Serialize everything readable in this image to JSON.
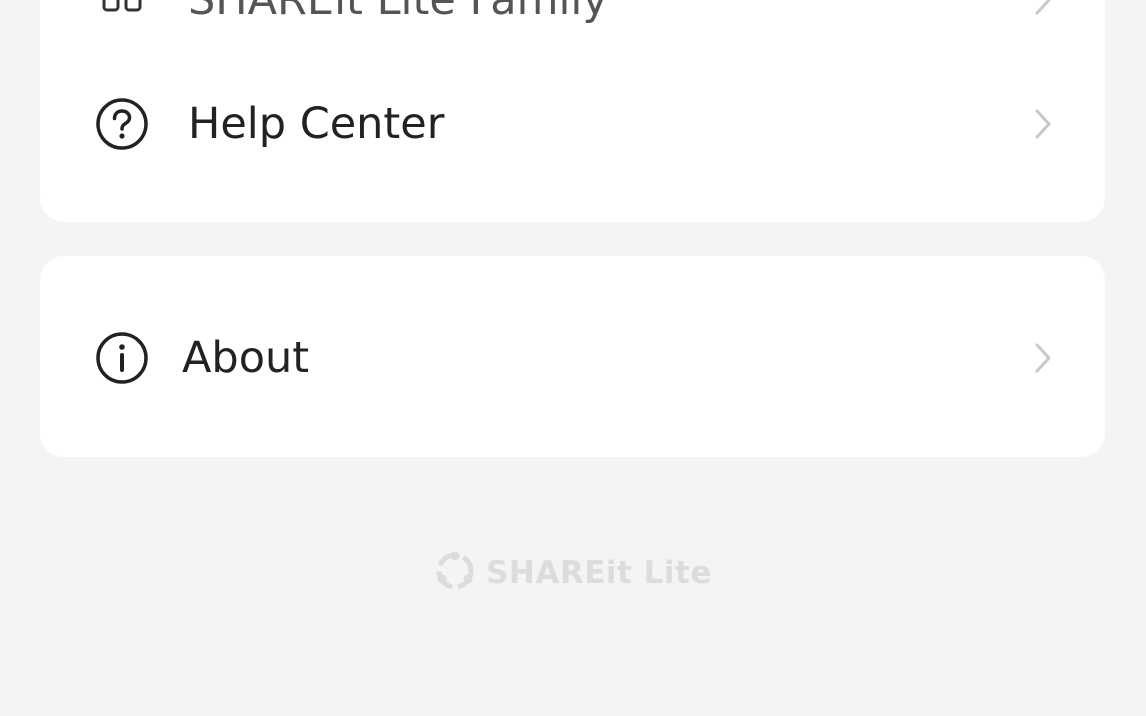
{
  "menu": {
    "card1": {
      "items": [
        {
          "label": "SHAREit Lite Family",
          "icon": "family-icon"
        },
        {
          "label": "Help Center",
          "icon": "question-circle-icon"
        }
      ]
    },
    "card2": {
      "items": [
        {
          "label": "About",
          "icon": "info-circle-icon"
        }
      ]
    }
  },
  "footer": {
    "brand_name": "SHAREit Lite",
    "brand_icon": "shareit-logo-icon"
  },
  "colors": {
    "background": "#f4f4f4",
    "card": "#ffffff",
    "text": "#222222",
    "chevron": "#c8c8c8",
    "footer_brand": "#dcdcdc"
  }
}
